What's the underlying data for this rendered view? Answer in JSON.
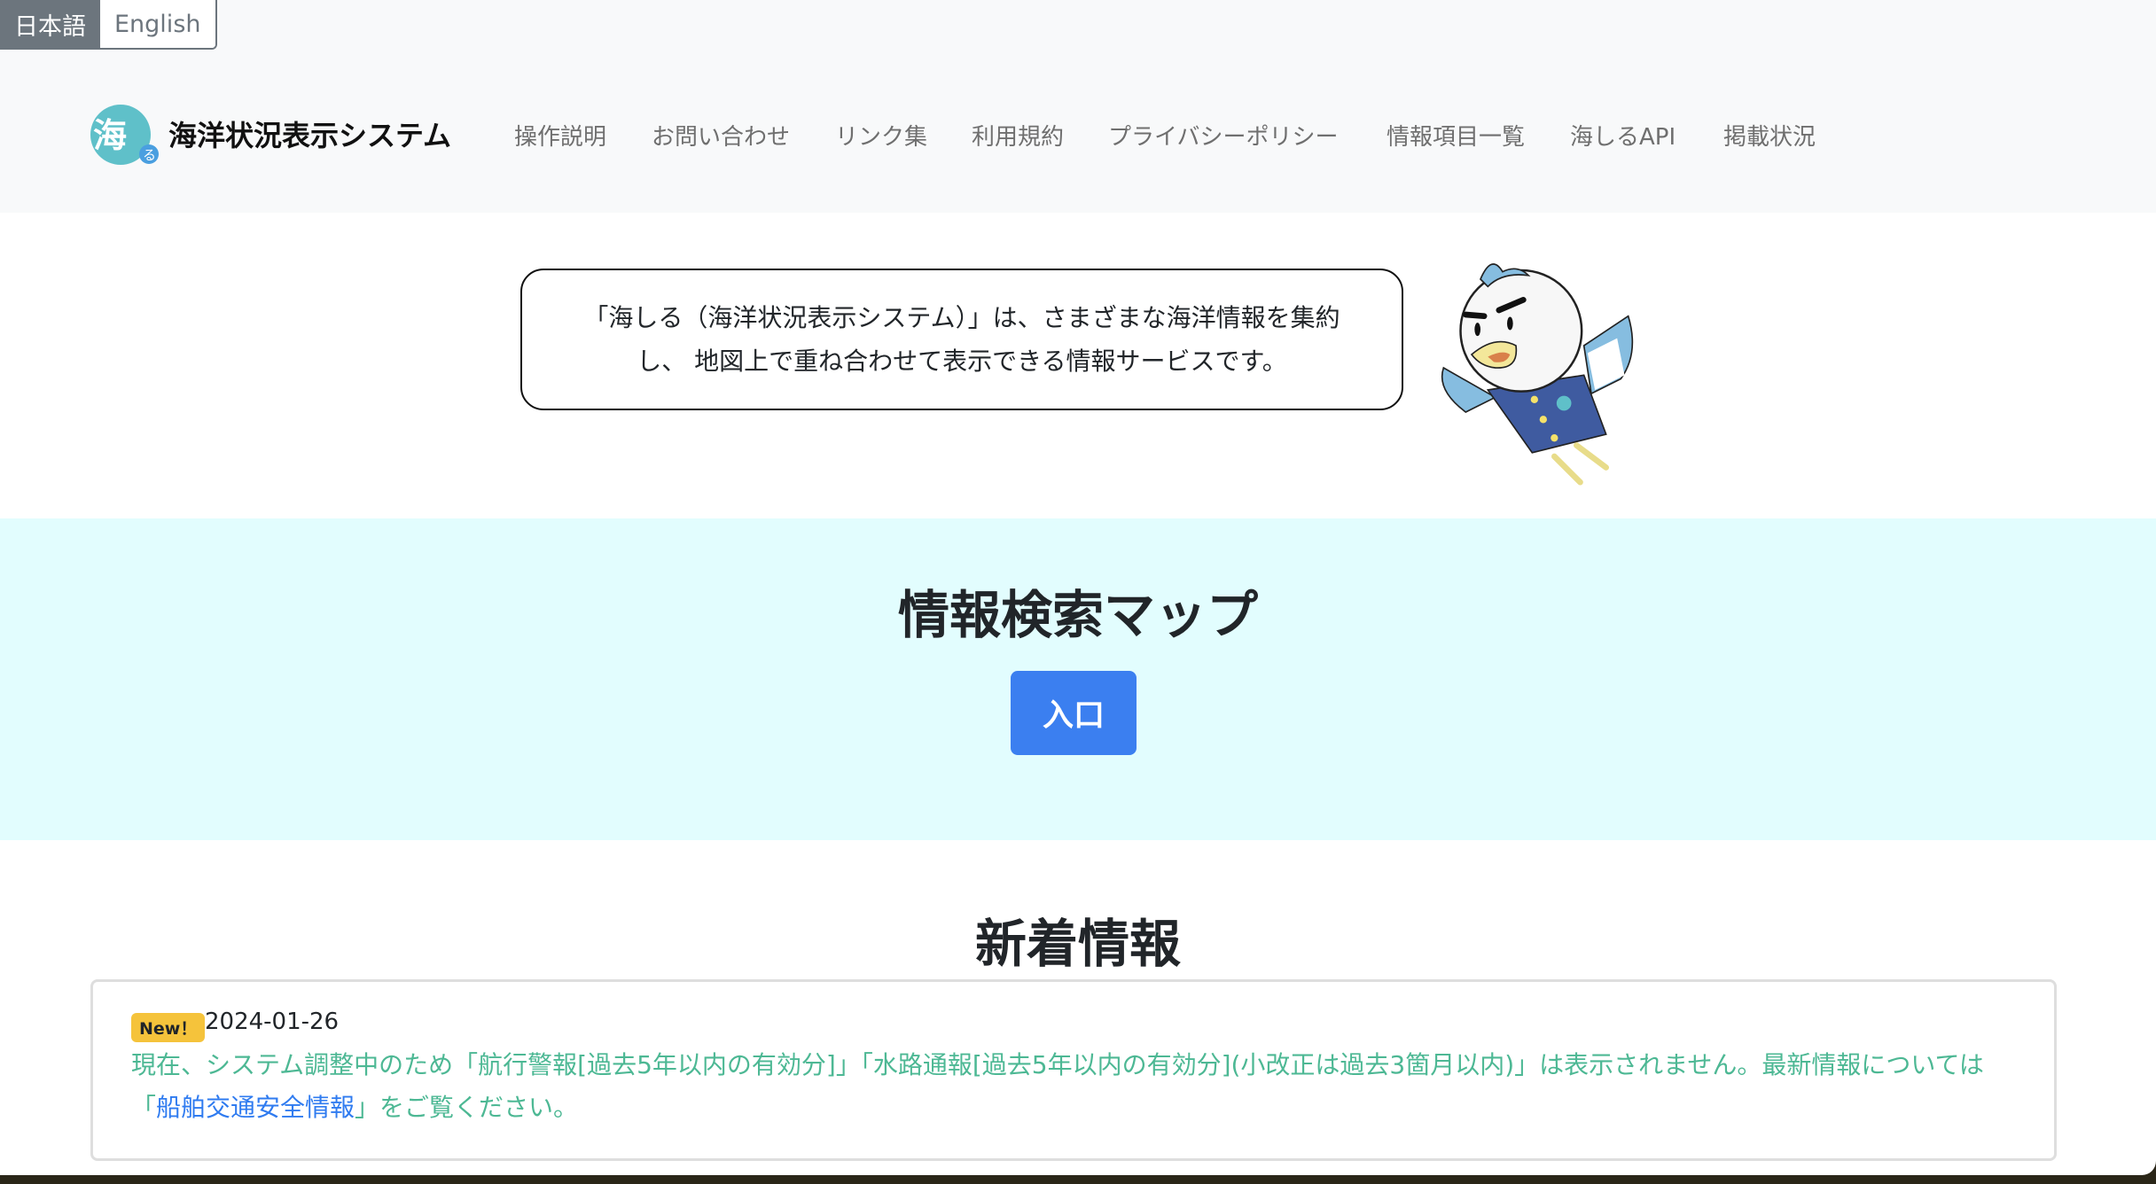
{
  "language": {
    "japanese": "日本語",
    "english": "English",
    "selected": "日本語"
  },
  "header": {
    "logo_text": "海しる",
    "title": "海洋状況表示システム",
    "nav": [
      "操作説明",
      "お問い合わせ",
      "リンク集",
      "利用規約",
      "プライバシーポリシー",
      "情報項目一覧",
      "海しるAPI",
      "掲載状況"
    ]
  },
  "hero": {
    "intro_line1": "「海しる（海洋状況表示システム）」は、さまざまな海洋情報を集約",
    "intro_line2": "し、 地図上で重ね合わせて表示できる情報サービスです。"
  },
  "map_section": {
    "title": "情報検索マップ",
    "enter_button": "入口"
  },
  "news": {
    "title": "新着情報",
    "items": [
      {
        "badge": "New！",
        "date": "2024-01-26",
        "text_before": "現在、システム調整中のため「航行警報[過去5年以内の有効分]」「水路通報[過去5年以内の有効分](小改正は過去3箇月以内)」は表示されません。最新情報については「",
        "link": "船舶交通安全情報",
        "text_after": "」をご覧ください。"
      }
    ]
  },
  "colors": {
    "accent_blue": "#3b7ff0",
    "map_bg": "#e2fdfe",
    "news_text": "#4db894",
    "badge": "#f5c33b"
  }
}
